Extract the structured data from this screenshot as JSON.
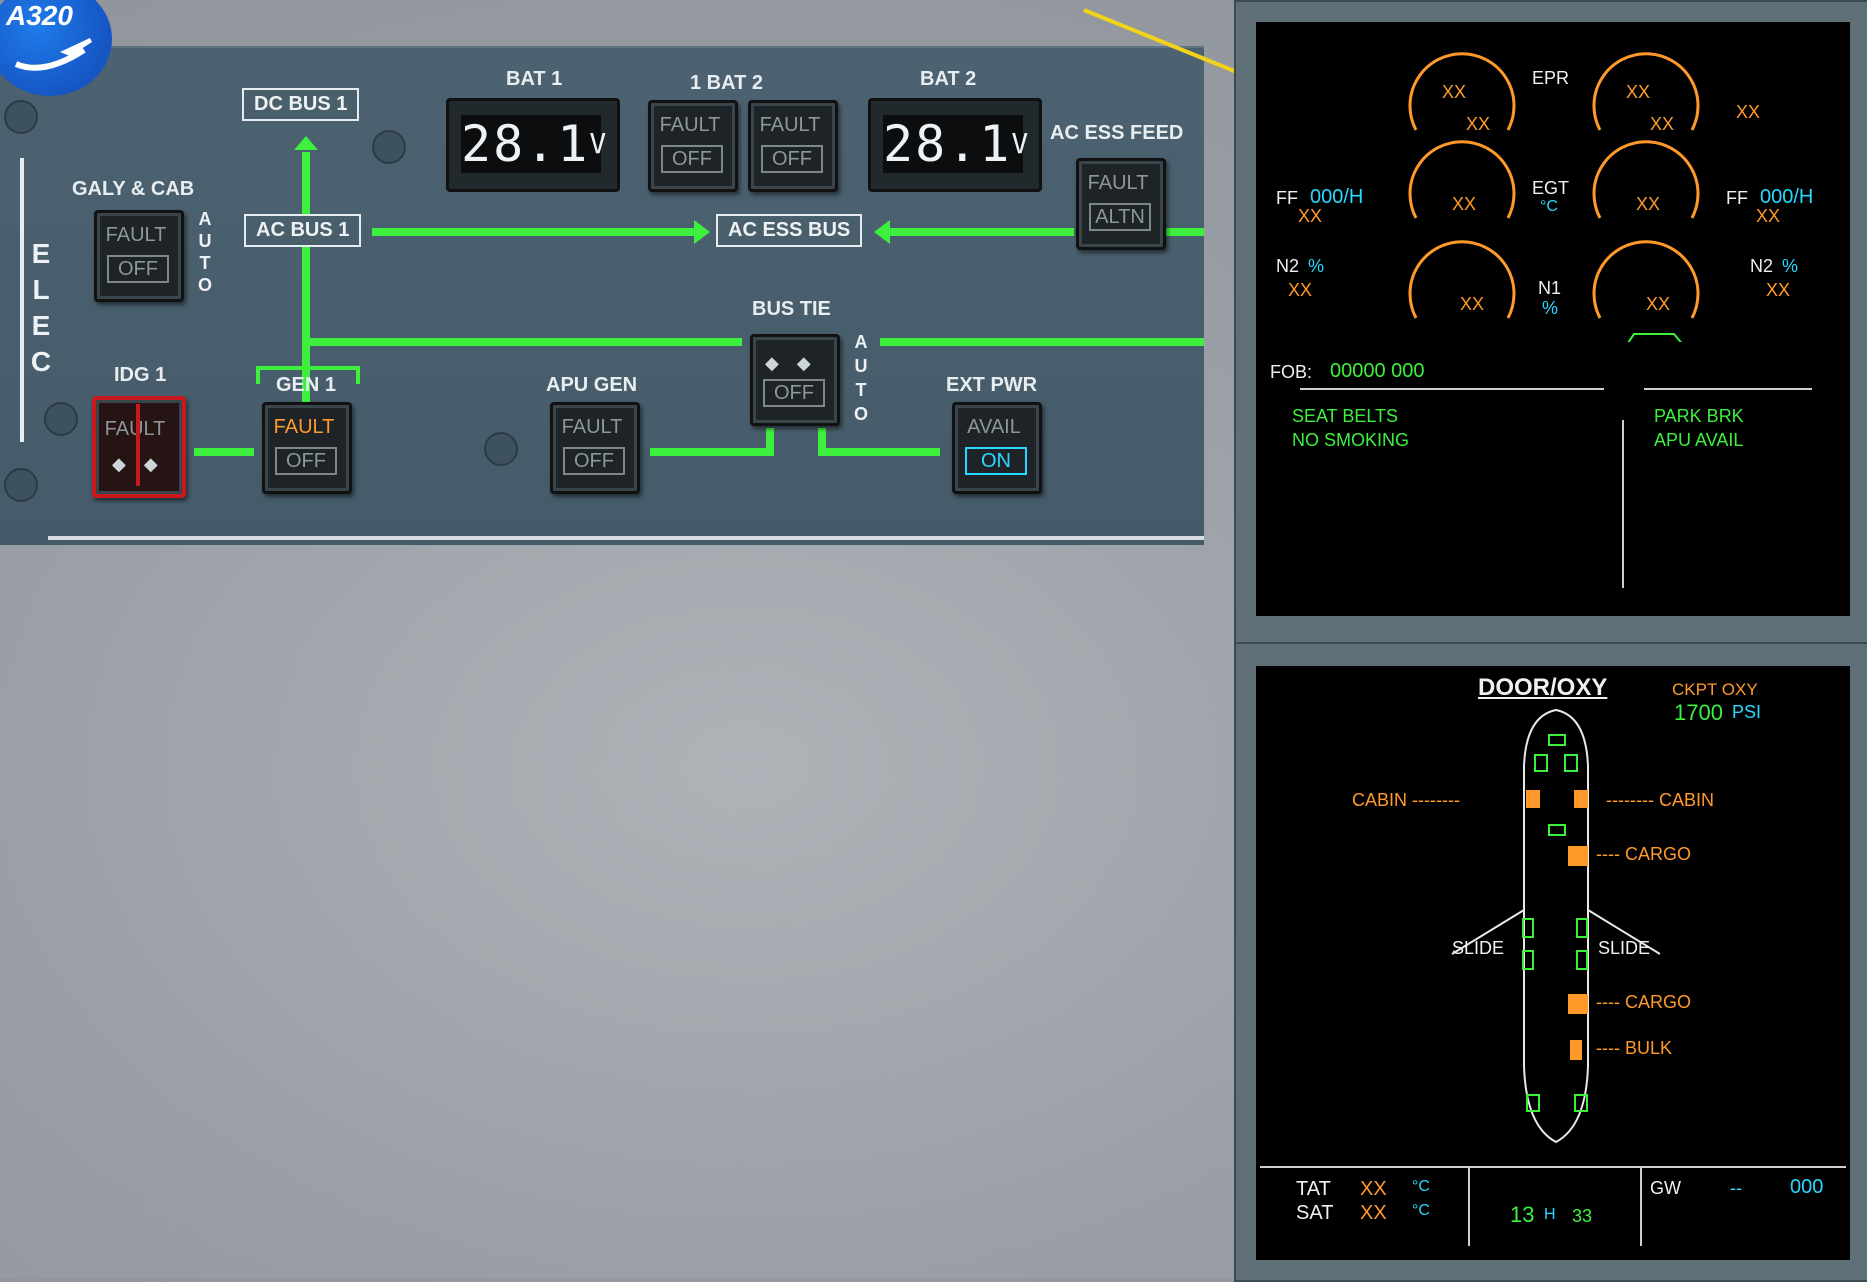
{
  "logo": {
    "text": "A320"
  },
  "elec": {
    "side_label": [
      "E",
      "L",
      "E",
      "C"
    ],
    "bat1_label": "BAT 1",
    "bat2_label": "BAT 2",
    "bat_pair_label": "1  BAT  2",
    "bat1_voltage": "28.1",
    "bat2_voltage": "28.1",
    "volt_unit": "V",
    "dc_bus_1": "DC BUS 1",
    "ac_bus_1": "AC BUS 1",
    "ac_ess_bus": "AC ESS BUS",
    "ac_ess_feed": "AC ESS FEED",
    "galy_cab": "GALY & CAB",
    "auto_vertical": [
      "A",
      "U",
      "T",
      "O"
    ],
    "idg1": "IDG 1",
    "gen1": "GEN 1",
    "apu_gen": "APU GEN",
    "bus_tie": "BUS TIE",
    "ext_pwr": "EXT PWR",
    "fault": "FAULT",
    "off": "OFF",
    "altn": "ALTN",
    "avail": "AVAIL",
    "on": "ON",
    "line_color": "#3ef03e"
  },
  "upper_ecam": {
    "epr": "EPR",
    "egt": "EGT",
    "egt_unit": "°C",
    "n1": "N1",
    "n1_unit": "%",
    "xx": "XX",
    "ff_label": "FF",
    "ff_value": "000/H",
    "n2_label": "N2",
    "n2_unit": "%",
    "fob_label": "FOB:",
    "fob_value": "00000 000",
    "memo_left": [
      "SEAT BELTS",
      "NO SMOKING"
    ],
    "memo_right": [
      "PARK BRK",
      "APU AVAIL"
    ]
  },
  "lower_ecam": {
    "title": "DOOR/OXY",
    "ckpt_oxy": "CKPT OXY",
    "ckpt_oxy_value": "1700",
    "psi": "PSI",
    "cabin": "CABIN",
    "cargo": "CARGO",
    "slide": "SLIDE",
    "bulk": "BULK",
    "tat": "TAT",
    "sat": "SAT",
    "temp_unit": "°C",
    "xx": "XX",
    "time_h": "13",
    "h": "H",
    "time_m": "33",
    "gw": "GW",
    "gw_dashes": "--",
    "gw_value": "000"
  }
}
